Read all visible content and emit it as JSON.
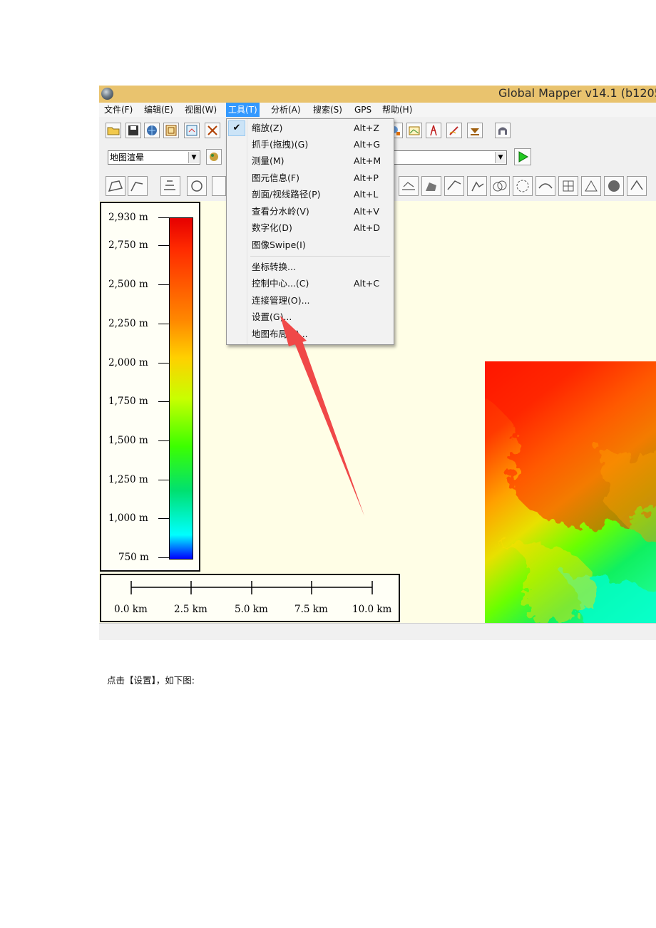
{
  "window": {
    "title": "Global Mapper v14.1 (b1205"
  },
  "menubar": {
    "items": [
      {
        "label": "文件(F)"
      },
      {
        "label": "编辑(E)"
      },
      {
        "label": "视图(W)"
      },
      {
        "label": "工具(T)",
        "active": true
      },
      {
        "label": "分析(A)"
      },
      {
        "label": "搜索(S)"
      },
      {
        "label": "GPS"
      },
      {
        "label": "帮助(H)"
      }
    ]
  },
  "toolbar": {
    "layer_select_value": "地图渲晕"
  },
  "tools_menu": {
    "items": [
      {
        "label": "缩放(Z)",
        "shortcut": "Alt+Z",
        "checked": true
      },
      {
        "label": "抓手(拖拽)(G)",
        "shortcut": "Alt+G"
      },
      {
        "label": "测量(M)",
        "shortcut": "Alt+M"
      },
      {
        "label": "图元信息(F)",
        "shortcut": "Alt+P"
      },
      {
        "label": "剖面/视线路径(P)",
        "shortcut": "Alt+L"
      },
      {
        "label": "查看分水岭(V)",
        "shortcut": "Alt+V"
      },
      {
        "label": "数字化(D)",
        "shortcut": "Alt+D"
      },
      {
        "label": "图像Swipe(I)",
        "shortcut": ""
      },
      {
        "label": "坐标转换...",
        "shortcut": ""
      },
      {
        "label": "控制中心...(C)",
        "shortcut": "Alt+C"
      },
      {
        "label": "连接管理(O)...",
        "shortcut": ""
      },
      {
        "label": "设置(G)...",
        "shortcut": ""
      },
      {
        "label": "地图布局(L)...",
        "shortcut": ""
      }
    ]
  },
  "legend": {
    "labels": [
      "2,930 m",
      "2,750 m",
      "2,500 m",
      "2,250 m",
      "2,000 m",
      "1,750 m",
      "1,500 m",
      "1,250 m",
      "1,000 m",
      "750 m"
    ],
    "colors": [
      "#e60000",
      "#ff8800",
      "#ffd000",
      "#3cff00",
      "#00ffff",
      "#0000ff"
    ]
  },
  "scalebar": {
    "labels": [
      "0.0 km",
      "2.5 km",
      "5.0 km",
      "7.5 km",
      "10.0 km"
    ]
  },
  "caption": "点击【设置】，如下图:",
  "annotation": {
    "arrow_color": "#f04040"
  }
}
